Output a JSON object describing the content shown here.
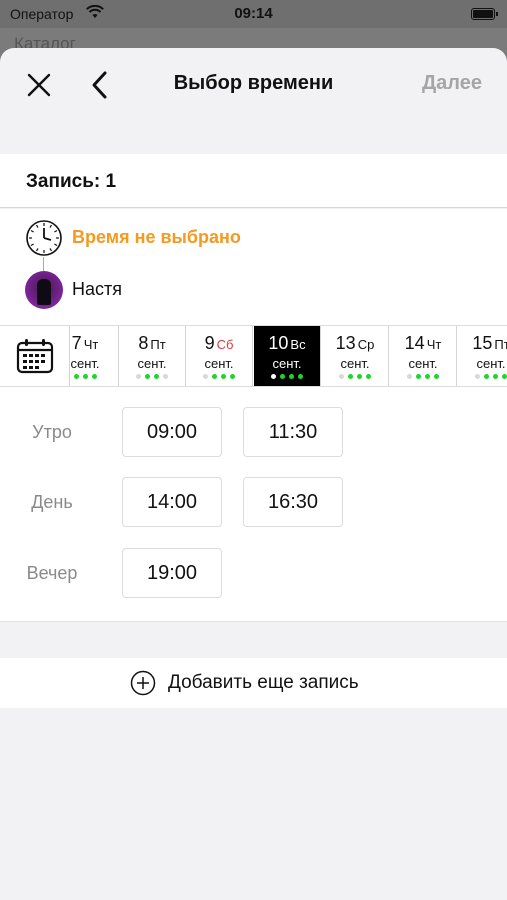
{
  "statusbar": {
    "carrier": "Оператор",
    "time": "09:14"
  },
  "behind_title": "Каталог",
  "nav": {
    "title": "Выбор времени",
    "next": "Далее"
  },
  "record": {
    "label": "Запись: 1"
  },
  "info": {
    "time_status": "Время не выбрано",
    "master_name": "Настя"
  },
  "dates": [
    {
      "num": "7",
      "wd": "Чт",
      "month": "сент.",
      "dots": [
        "on",
        "on",
        "on"
      ]
    },
    {
      "num": "8",
      "wd": "Пт",
      "month": "сент.",
      "dots": [
        "off",
        "on",
        "on",
        "off"
      ]
    },
    {
      "num": "9",
      "wd": "Сб",
      "month": "сент.",
      "dots": [
        "off",
        "on",
        "on",
        "on"
      ],
      "weekend": true
    },
    {
      "num": "10",
      "wd": "Вс",
      "month": "сент.",
      "dots": [
        "on",
        "on",
        "on",
        "on"
      ],
      "selected": true
    },
    {
      "num": "13",
      "wd": "Ср",
      "month": "сент.",
      "dots": [
        "off",
        "on",
        "on",
        "on"
      ]
    },
    {
      "num": "14",
      "wd": "Чт",
      "month": "сент.",
      "dots": [
        "off",
        "on",
        "on",
        "on"
      ]
    },
    {
      "num": "15",
      "wd": "Пт",
      "month": "сент.",
      "dots": [
        "off",
        "on",
        "on",
        "on"
      ]
    }
  ],
  "periods": [
    {
      "name": "Утро",
      "times": [
        "09:00",
        "11:30"
      ]
    },
    {
      "name": "День",
      "times": [
        "14:00",
        "16:30"
      ]
    },
    {
      "name": "Вечер",
      "times": [
        "19:00"
      ]
    }
  ],
  "add_record": {
    "label": "Добавить еще запись"
  },
  "colors": {
    "accent_orange": "#f39a1f",
    "available_green": "#1fd628",
    "weekend_red": "#e0393e",
    "selected_bg": "#000000"
  }
}
